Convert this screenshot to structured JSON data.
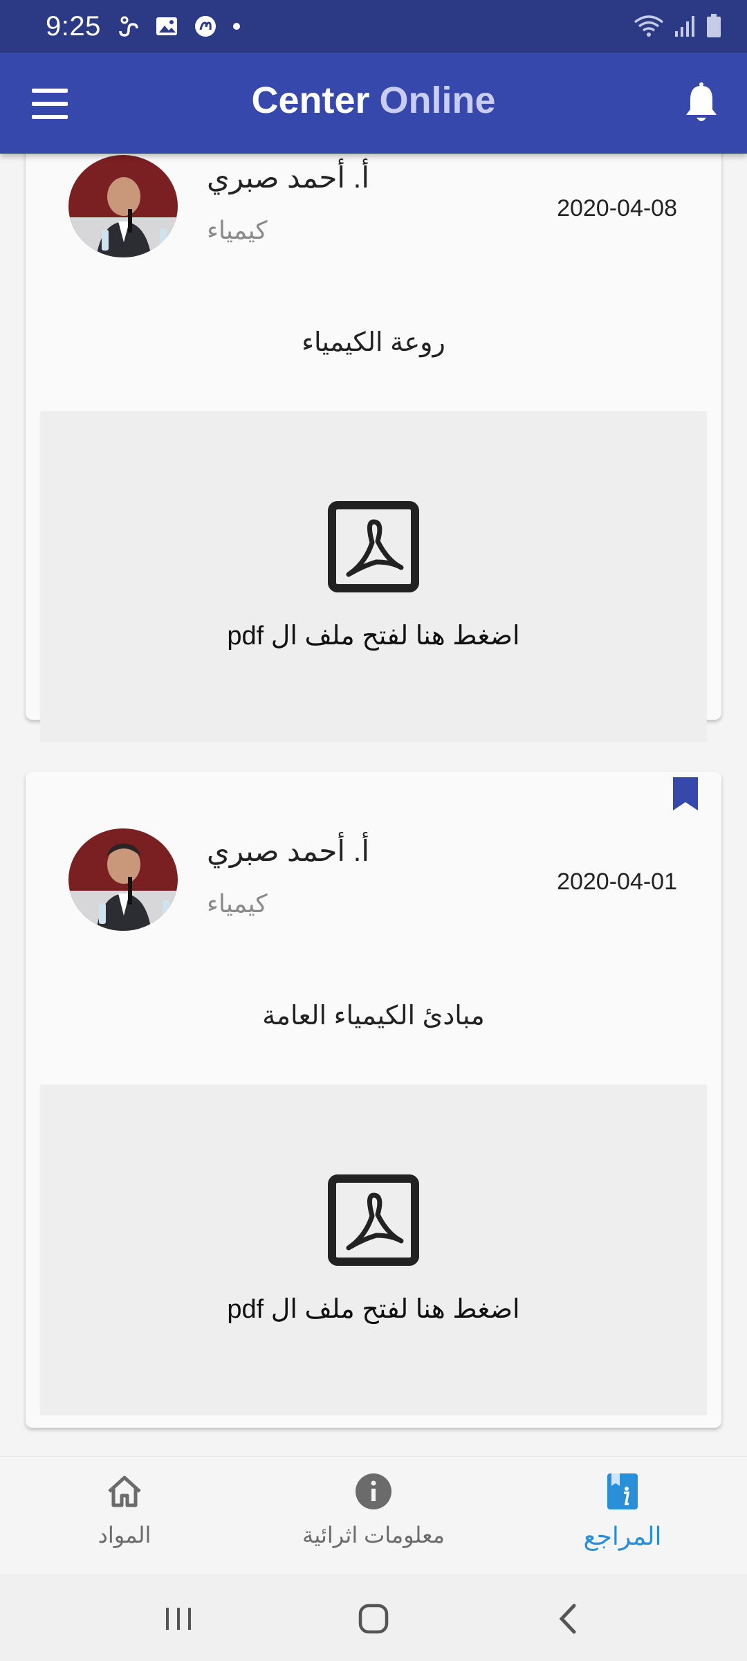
{
  "status_bar": {
    "time": "9:25",
    "left_icons": [
      "link-icon",
      "image-icon",
      "app-icon",
      "dot-icon"
    ],
    "right_icons": [
      "wifi-icon",
      "signal-icon",
      "battery-icon"
    ]
  },
  "app_bar": {
    "title_part1": "Center",
    "title_part2": "Online",
    "menu_icon": "hamburger-menu-icon",
    "notification_icon": "bell-icon"
  },
  "posts": [
    {
      "author_name": "أ. أحمد صبري",
      "subject": "كيمياء",
      "date": "2020-04-08",
      "title": "روعة الكيمياء",
      "pdf_label": "اضغط هنا لفتح ملف ال pdf",
      "bookmarked": false
    },
    {
      "author_name": "أ. أحمد صبري",
      "subject": "كيمياء",
      "date": "2020-04-01",
      "title": "مبادئ الكيمياء العامة",
      "pdf_label": "اضغط هنا لفتح ملف ال pdf",
      "bookmarked": true
    }
  ],
  "bottom_nav": {
    "items": [
      {
        "label": "المواد",
        "icon": "home-icon",
        "active": false
      },
      {
        "label": "معلومات اثرائية",
        "icon": "info-icon",
        "active": false
      },
      {
        "label": "المراجع",
        "icon": "book-info-icon",
        "active": true
      }
    ]
  },
  "colors": {
    "status_bar": "#2c3a86",
    "app_bar": "#3748ad",
    "active_nav": "#2a8fd9",
    "bookmark": "#3748ad"
  }
}
